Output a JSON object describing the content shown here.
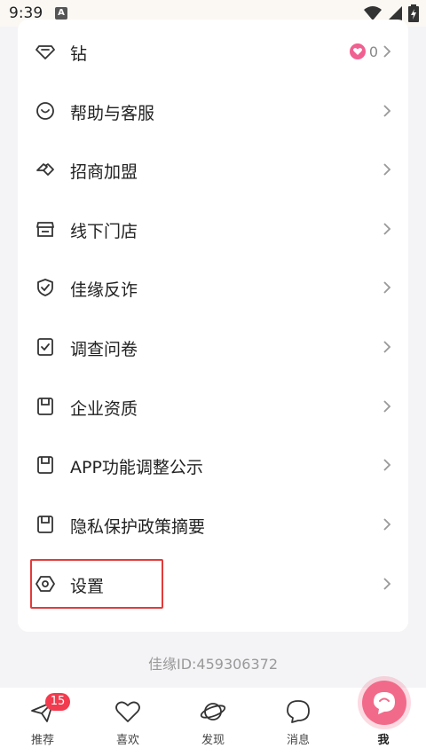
{
  "status_bar": {
    "time": "9:39",
    "notif_letter": "A"
  },
  "menu": {
    "items": [
      {
        "label": "钻",
        "icon": "diamond-icon",
        "badge_count": "0"
      },
      {
        "label": "帮助与客服",
        "icon": "smile-icon"
      },
      {
        "label": "招商加盟",
        "icon": "handshake-icon"
      },
      {
        "label": "线下门店",
        "icon": "store-icon"
      },
      {
        "label": "佳缘反诈",
        "icon": "shield-check-icon"
      },
      {
        "label": "调查问卷",
        "icon": "survey-icon"
      },
      {
        "label": "企业资质",
        "icon": "document-icon"
      },
      {
        "label": "APP功能调整公示",
        "icon": "document-icon"
      },
      {
        "label": "隐私保护政策摘要",
        "icon": "document-icon"
      },
      {
        "label": "设置",
        "icon": "settings-icon"
      }
    ]
  },
  "user_id": "佳缘ID:459306372",
  "tabbar": {
    "tabs": [
      {
        "label": "推荐",
        "icon": "paper-plane-icon",
        "badge": "15"
      },
      {
        "label": "喜欢",
        "icon": "heart-icon"
      },
      {
        "label": "发现",
        "icon": "planet-icon"
      },
      {
        "label": "消息",
        "icon": "chat-bubble-icon"
      },
      {
        "label": "我",
        "icon": "profile-icon",
        "active": true
      }
    ]
  },
  "colors": {
    "accent": "#f26a8a",
    "badge_red": "#f23b4e",
    "highlight_border": "#e23b3b"
  }
}
